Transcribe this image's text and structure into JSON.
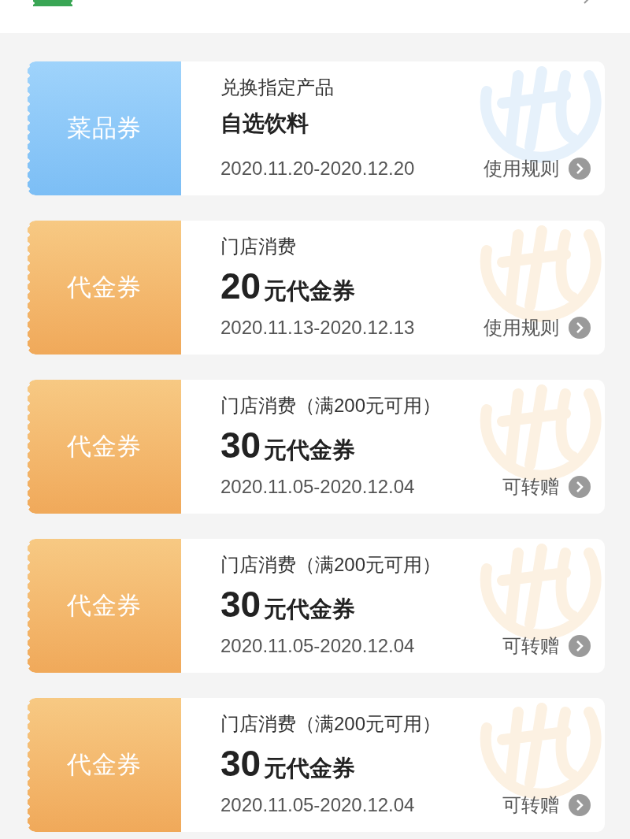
{
  "coupons": [
    {
      "kind": "dish",
      "type_label": "菜品券",
      "scope": "兑换指定产品",
      "name": "自选饮料",
      "dates": "2020.11.20-2020.12.20",
      "action": "使用规则"
    },
    {
      "kind": "cash",
      "type_label": "代金券",
      "scope": "门店消费",
      "amount": "20",
      "name": "元代金券",
      "dates": "2020.11.13-2020.12.13",
      "action": "使用规则"
    },
    {
      "kind": "cash",
      "type_label": "代金券",
      "scope": "门店消费（满200元可用）",
      "amount": "30",
      "name": "元代金券",
      "dates": "2020.11.05-2020.12.04",
      "action": "可转赠"
    },
    {
      "kind": "cash",
      "type_label": "代金券",
      "scope": "门店消费（满200元可用）",
      "amount": "30",
      "name": "元代金券",
      "dates": "2020.11.05-2020.12.04",
      "action": "可转赠"
    },
    {
      "kind": "cash",
      "type_label": "代金券",
      "scope": "门店消费（满200元可用）",
      "amount": "30",
      "name": "元代金券",
      "dates": "2020.11.05-2020.12.04",
      "action": "可转赠"
    }
  ]
}
